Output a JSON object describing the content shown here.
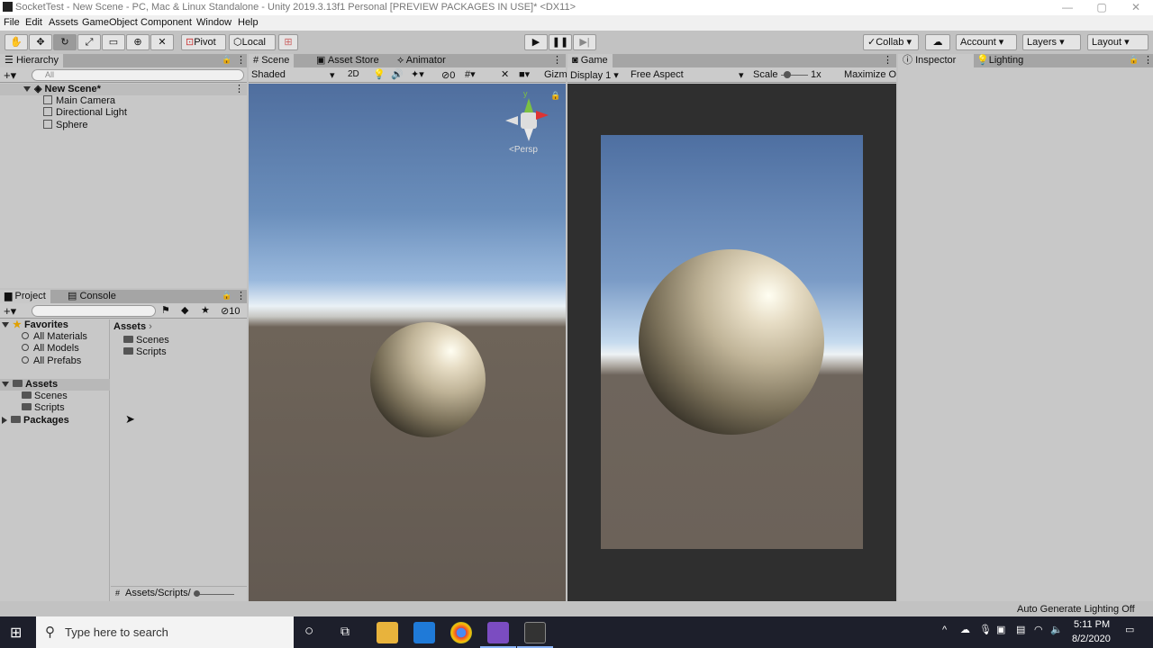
{
  "window": {
    "title": "SocketTest - New Scene - PC, Mac & Linux Standalone - Unity 2019.3.13f1 Personal [PREVIEW PACKAGES IN USE]* <DX11>"
  },
  "menu": [
    "File",
    "Edit",
    "Assets",
    "GameObject",
    "Component",
    "Window",
    "Help"
  ],
  "toolbar": {
    "pivot_label": "Pivot",
    "local_label": "Local",
    "collab_label": "Collab",
    "account_label": "Account",
    "layers_label": "Layers",
    "layout_label": "Layout"
  },
  "hierarchy": {
    "tab_label": "Hierarchy",
    "search_placeholder": "All",
    "scene_name": "New Scene*",
    "items": [
      "Main Camera",
      "Directional Light",
      "Sphere"
    ]
  },
  "scene_panel": {
    "tabs": [
      "Scene",
      "Asset Store",
      "Animator"
    ],
    "shading_mode": "Shaded",
    "mode_2d": "2D",
    "hidden_count": "0",
    "gizmos_label": "Gizm",
    "persp_label": "<Persp"
  },
  "game_panel": {
    "tab_label": "Game",
    "display": "Display 1",
    "aspect": "Free Aspect",
    "scale_label": "Scale",
    "scale_value": "1x",
    "maximize_label": "Maximize O"
  },
  "inspector_panel": {
    "tabs": [
      "Inspector",
      "Lighting"
    ]
  },
  "project_panel": {
    "tabs": [
      "Project",
      "Console"
    ],
    "hidden_count": "10",
    "favorites_label": "Favorites",
    "favorites": [
      "All Materials",
      "All Models",
      "All Prefabs"
    ],
    "assets_label": "Assets",
    "asset_folders": [
      "Scenes",
      "Scripts"
    ],
    "packages_label": "Packages",
    "breadcrumb": "Assets",
    "content_items": [
      "Scenes",
      "Scripts"
    ],
    "path": "Assets/Scripts/"
  },
  "statusbar": {
    "message": "Auto Generate Lighting Off"
  },
  "taskbar": {
    "search_placeholder": "Type here to search",
    "time": "5:11 PM",
    "date": "8/2/2020"
  },
  "colors": {
    "panel_bg": "#c8c8c8",
    "tab_bg": "#a5a5a5",
    "taskbar_bg": "#1d1f2b",
    "game_frame": "#2f2f2f"
  }
}
